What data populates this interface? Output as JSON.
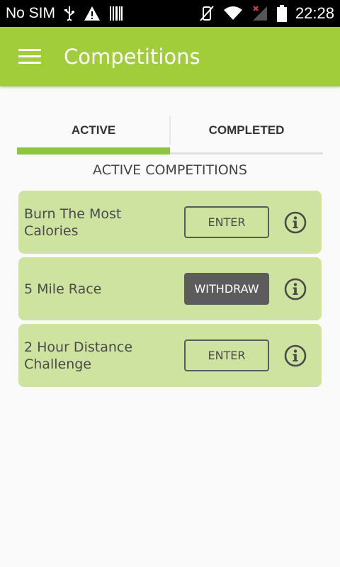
{
  "status_bar": {
    "carrier": "No SIM",
    "time": "22:28",
    "icons": [
      "usb-icon",
      "warning-icon",
      "barcode-icon",
      "vibrate-mute-icon",
      "wifi-icon",
      "signal-off-icon",
      "battery-icon"
    ]
  },
  "app_bar": {
    "title": "Competitions"
  },
  "tabs": [
    {
      "label": "ACTIVE",
      "selected": true
    },
    {
      "label": "COMPLETED",
      "selected": false
    }
  ],
  "section_title": "ACTIVE COMPETITIONS",
  "competitions": [
    {
      "name": "Burn The Most Calories",
      "action": "ENTER"
    },
    {
      "name": "5 Mile Race",
      "action": "WITHDRAW"
    },
    {
      "name": "2 Hour Distance Challenge",
      "action": "ENTER"
    }
  ],
  "colors": {
    "accent": "#a1cd3b",
    "tab_indicator": "#8cc63f",
    "card": "#cfe3a0",
    "withdraw_button": "#5c5c5c"
  }
}
